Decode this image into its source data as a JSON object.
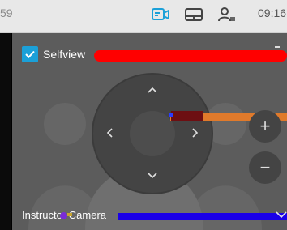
{
  "topbar": {
    "clock_fragment": "59",
    "time": "09:16",
    "icons": [
      "camera-icon",
      "touch-panel-icon",
      "participant-list-icon"
    ],
    "accent": "#1ba0d8"
  },
  "panel": {
    "selfview": {
      "label": "Selfview",
      "checked": true
    },
    "zoom": {
      "in_label": "+",
      "out_label": "−"
    },
    "camera_select": {
      "label": "Instructor Camera"
    }
  }
}
